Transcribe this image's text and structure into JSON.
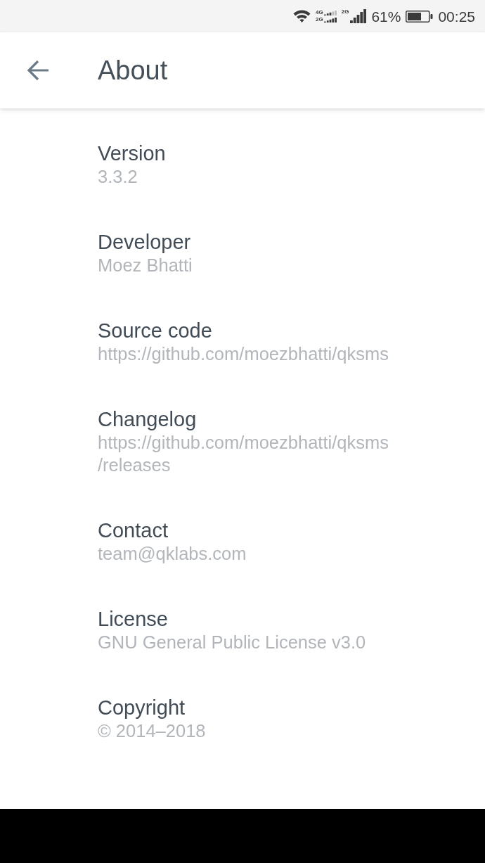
{
  "status_bar": {
    "signals": [
      {
        "labels": [
          "4G",
          "2G"
        ]
      },
      {
        "labels": [
          "2G"
        ]
      }
    ],
    "battery": "61%",
    "time": "00:25"
  },
  "toolbar": {
    "title": "About"
  },
  "items": [
    {
      "title": "Version",
      "value": "3.3.2"
    },
    {
      "title": "Developer",
      "value": "Moez Bhatti"
    },
    {
      "title": "Source code",
      "value": "https://github.com/moezbhatti/qksms"
    },
    {
      "title": "Changelog",
      "value": "https://github.com/moezbhatti/qksms/releases"
    },
    {
      "title": "Contact",
      "value": "team@qklabs.com"
    },
    {
      "title": "License",
      "value": "GNU General Public License v3.0"
    },
    {
      "title": "Copyright",
      "value": "© 2014–2018"
    }
  ]
}
